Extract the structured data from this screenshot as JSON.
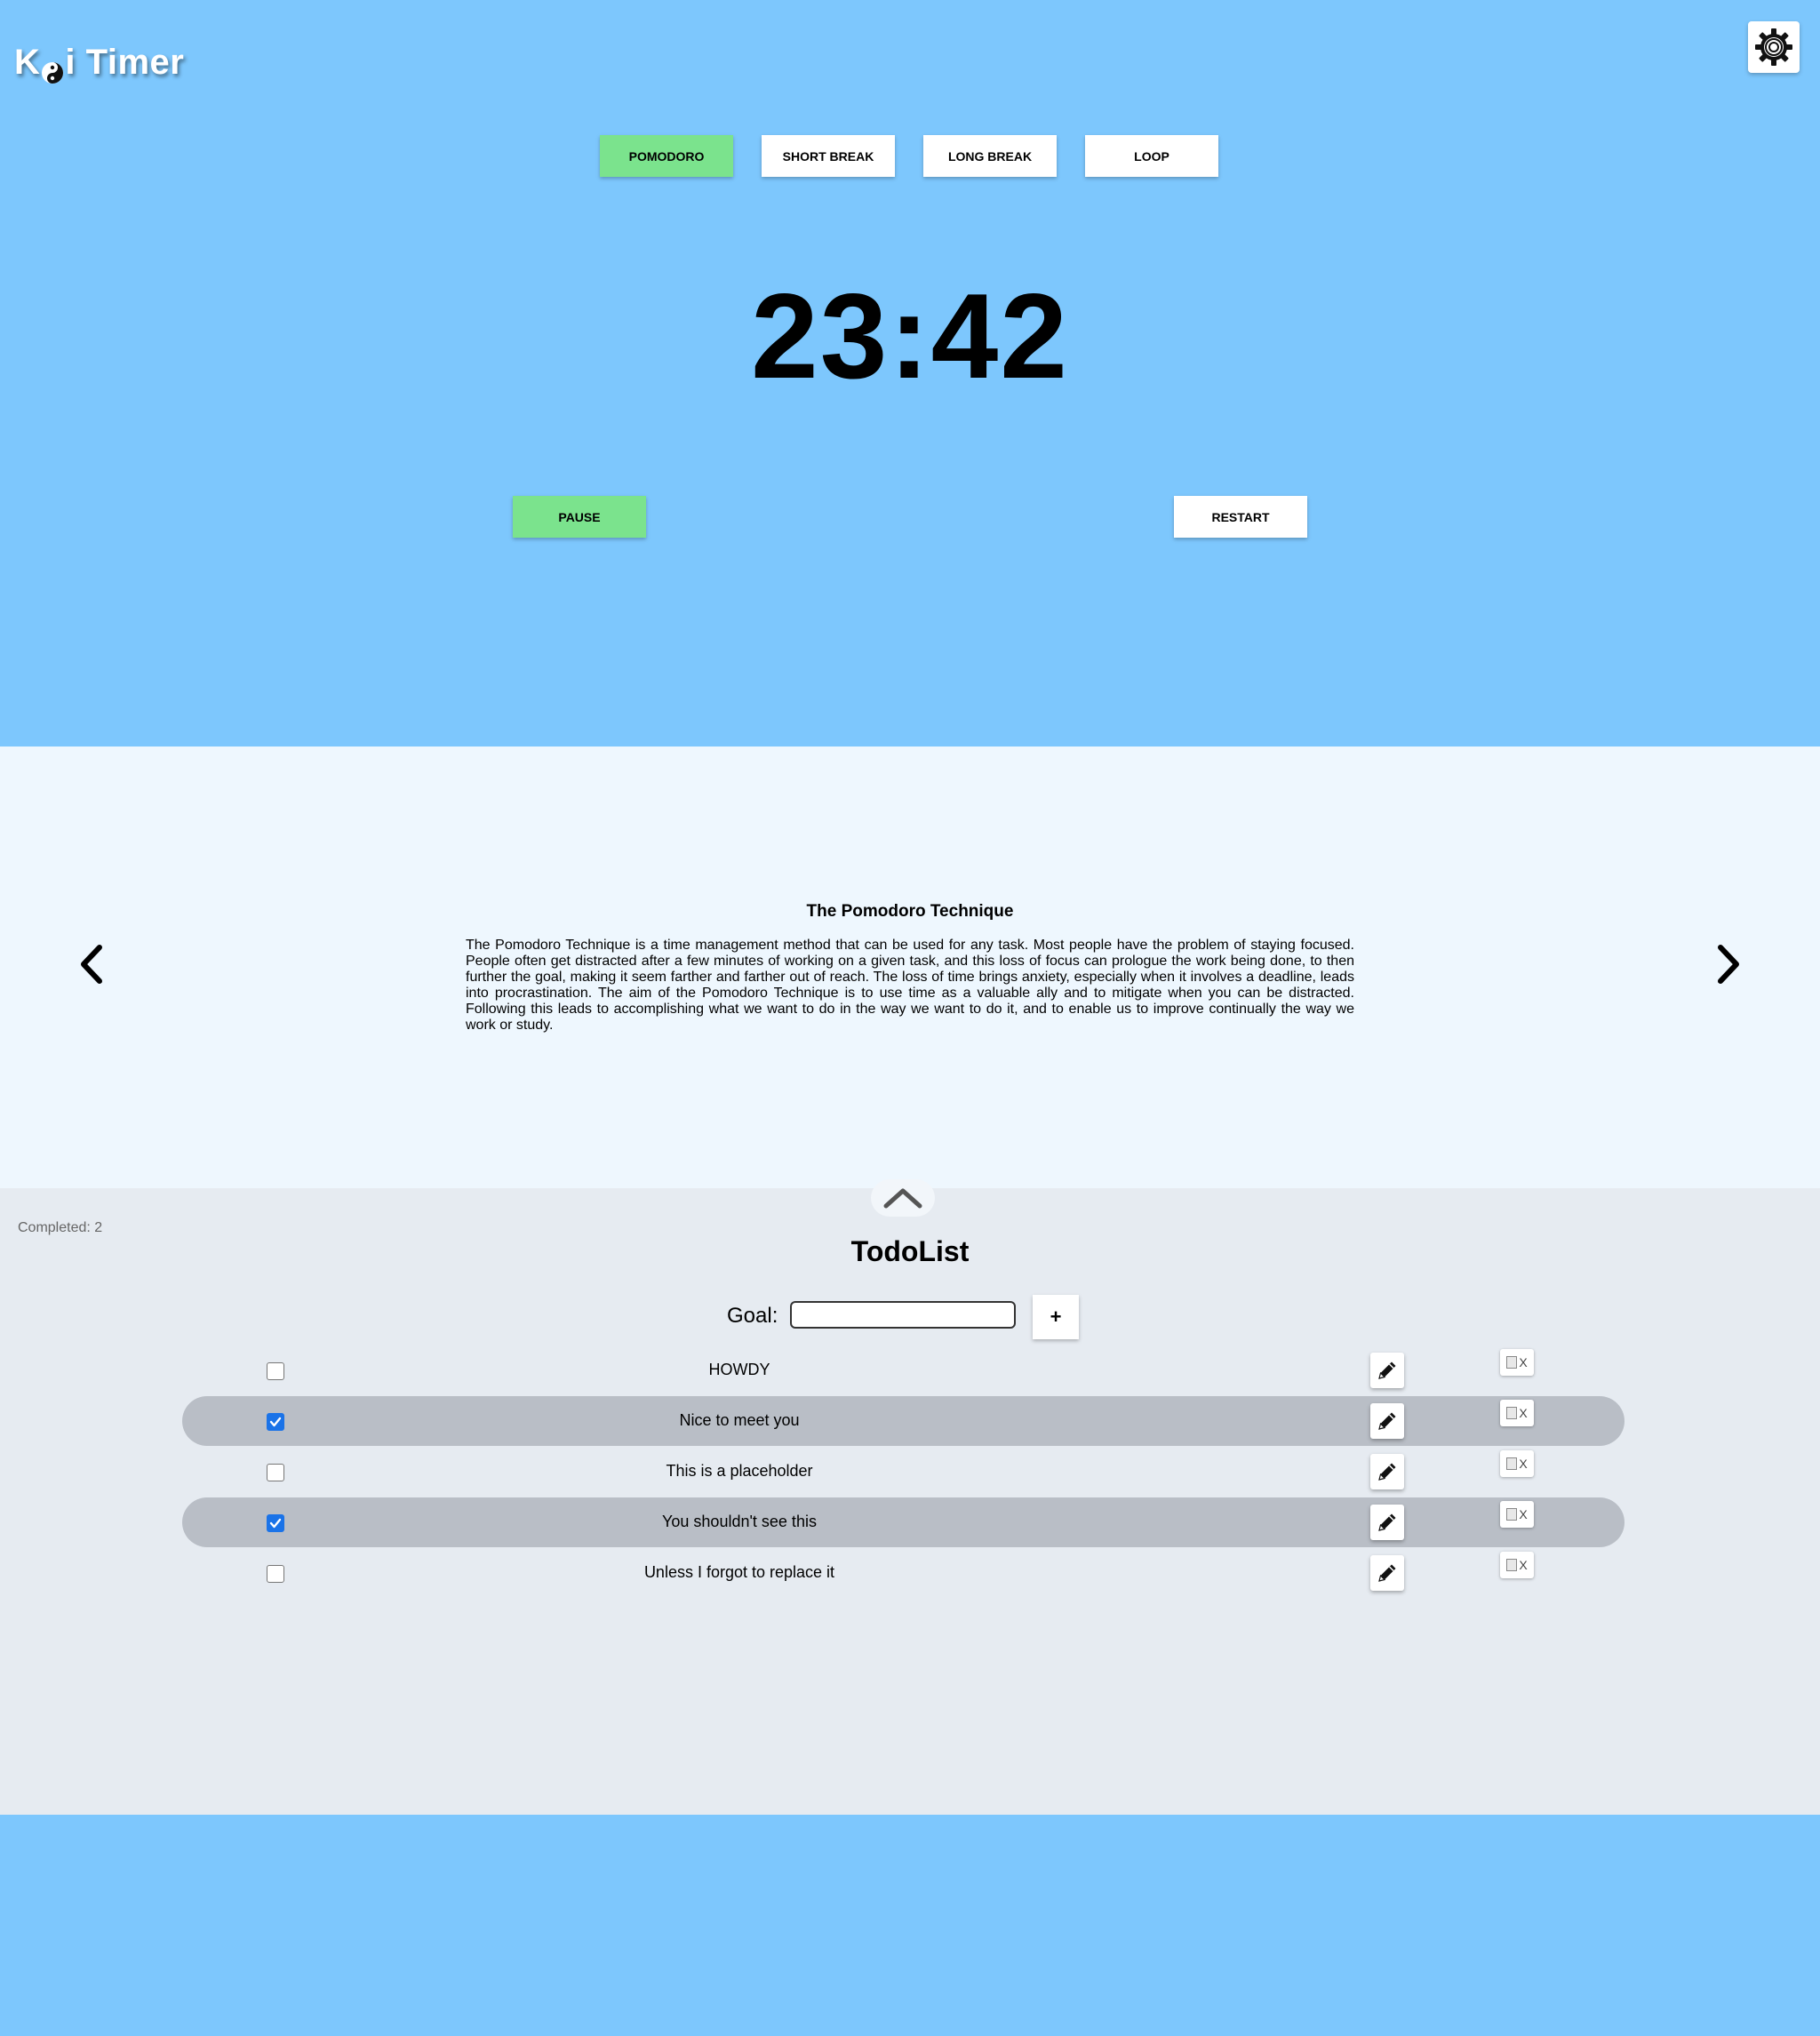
{
  "header": {
    "logo_before": "K",
    "logo_after": "i Timer",
    "settings_icon": "gear-icon"
  },
  "modes": [
    {
      "label": "POMODORO",
      "active": true
    },
    {
      "label": "SHORT BREAK",
      "active": false
    },
    {
      "label": "LONG BREAK",
      "active": false
    },
    {
      "label": "LOOP",
      "active": false
    }
  ],
  "timer": {
    "display": "23:42"
  },
  "controls": {
    "pause_label": "PAUSE",
    "restart_label": "RESTART"
  },
  "info": {
    "title": "The Pomodoro Technique",
    "body": "The Pomodoro Technique is a time management method that can be used for any task. Most people have the problem of staying focused. People often get distracted after a few minutes of working on a given task, and this loss of focus can prologue the work being done, to then further the goal, making it seem farther and farther out of reach. The loss of time brings anxiety, especially when it involves a deadline, leads into procrastination. The aim of the Pomodoro Technique is to use time as a valuable ally and to mitigate when you can be distracted. Following this leads to accomplishing what we want to do in the way we want to do it, and to enable us to improve continually the way we work or study.",
    "prev_icon": "chevron-left-icon",
    "next_icon": "chevron-right-icon"
  },
  "todo": {
    "collapse_icon": "chevron-up-icon",
    "completed_label": "Completed: 2",
    "title": "TodoList",
    "goal_label": "Goal:",
    "goal_value": "",
    "add_label": "+",
    "delete_alt": "X",
    "items": [
      {
        "text": "HOWDY",
        "done": false
      },
      {
        "text": "Nice to meet you",
        "done": true
      },
      {
        "text": "This is a placeholder",
        "done": false
      },
      {
        "text": "You shouldn't see this",
        "done": true
      },
      {
        "text": "Unless I forgot to replace it",
        "done": false
      }
    ]
  },
  "colors": {
    "background": "#7dc7fd",
    "active_button": "#7be38d",
    "info_bg": "#eef7fe",
    "todo_bg": "#e6ebf1",
    "done_row": "#b9bec6",
    "checkbox_checked": "#1a73e8"
  }
}
